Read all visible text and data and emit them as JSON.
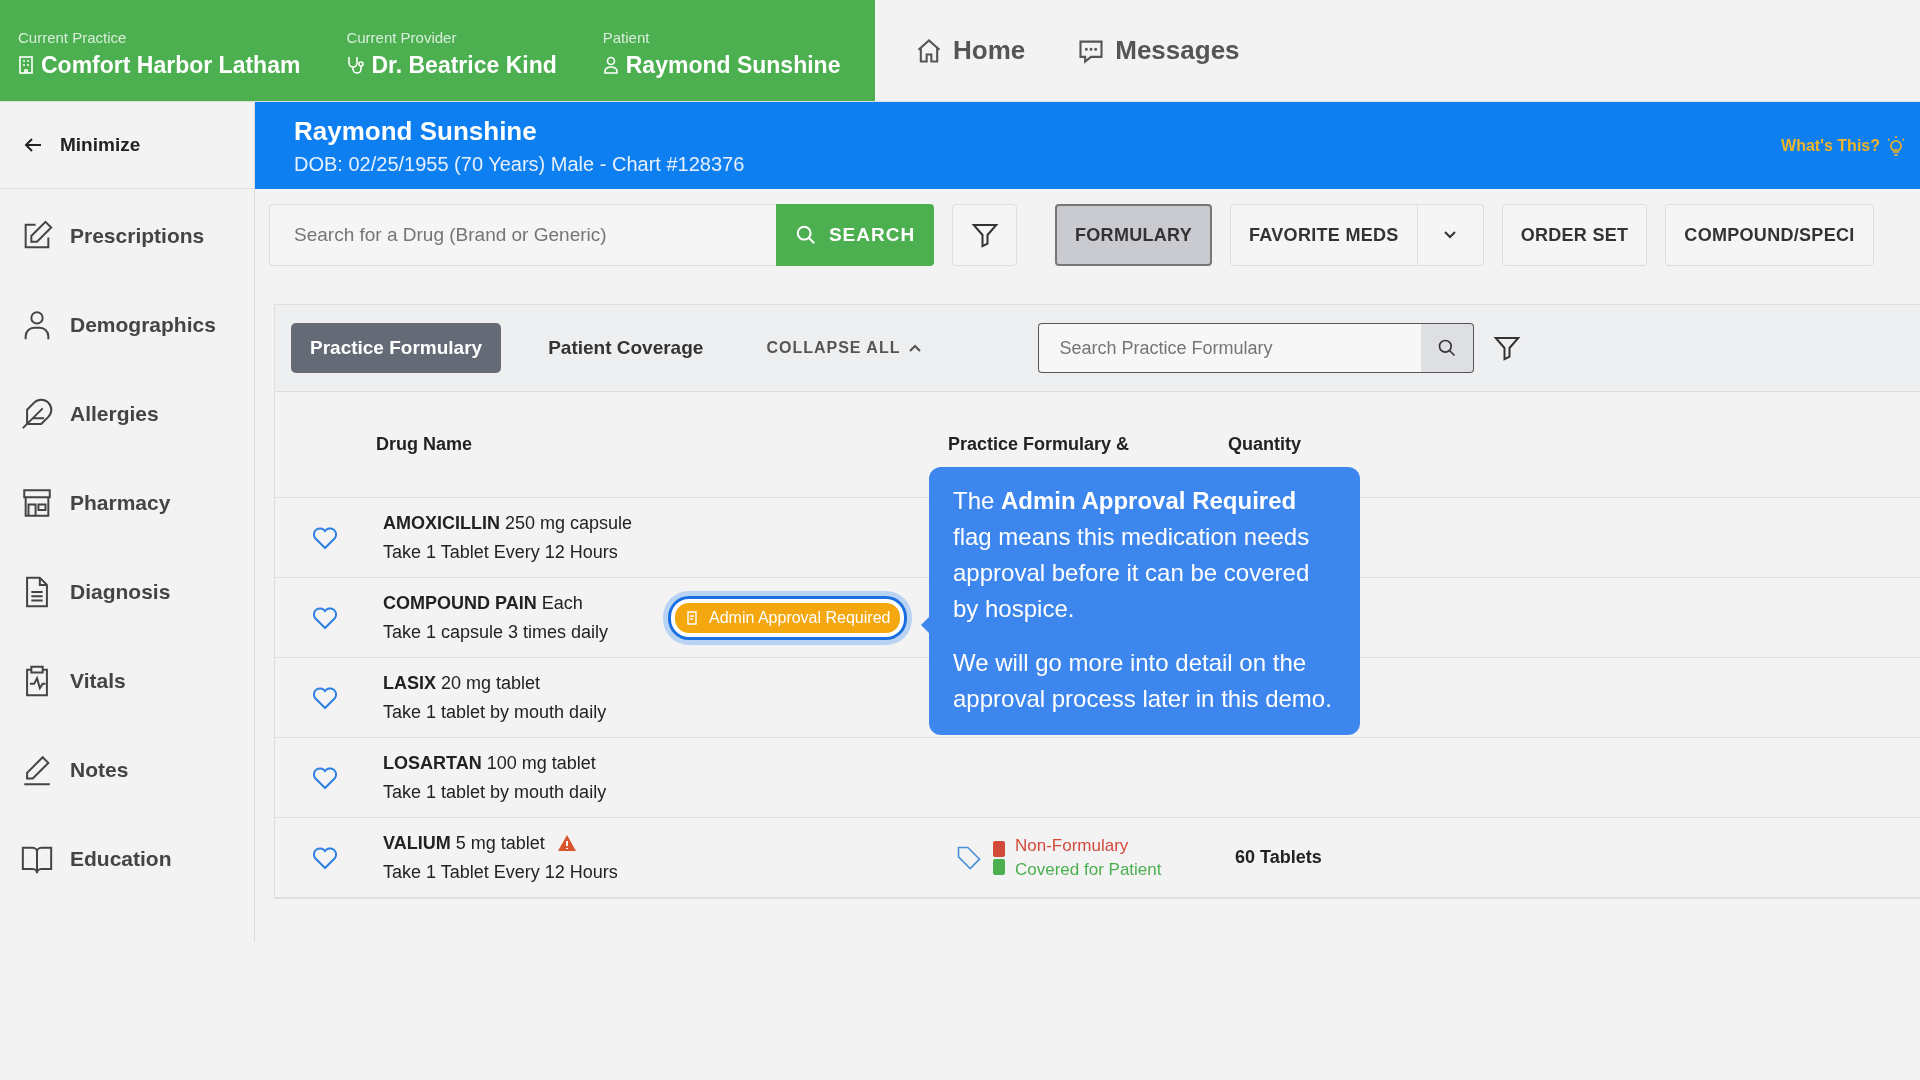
{
  "context_bar": [
    {
      "label": "Current Practice",
      "value": "Comfort Harbor Latham"
    },
    {
      "label": "Current Provider",
      "value": "Dr. Beatrice Kind"
    },
    {
      "label": "Patient",
      "value": "Raymond Sunshine"
    }
  ],
  "nav_links": [
    {
      "label": "Home"
    },
    {
      "label": "Messages"
    }
  ],
  "sidebar": {
    "minimize": "Minimize",
    "items": [
      {
        "label": "Prescriptions"
      },
      {
        "label": "Demographics"
      },
      {
        "label": "Allergies"
      },
      {
        "label": "Pharmacy"
      },
      {
        "label": "Diagnosis"
      },
      {
        "label": "Vitals"
      },
      {
        "label": "Notes"
      },
      {
        "label": "Education"
      }
    ]
  },
  "patient_banner": {
    "name": "Raymond Sunshine",
    "details": "DOB: 02/25/1955 (70 Years) Male - Chart #128376",
    "help_link": "What's This?"
  },
  "drug_search": {
    "placeholder": "Search for a Drug (Brand or Generic)",
    "button": "SEARCH"
  },
  "toolbar_buttons": [
    {
      "label": "FORMULARY",
      "selected": true,
      "dropdown": false
    },
    {
      "label": "FAVORITE MEDS",
      "selected": false,
      "dropdown": true
    },
    {
      "label": "ORDER SET",
      "selected": false,
      "dropdown": false
    },
    {
      "label": "COMPOUND/SPECI",
      "selected": false,
      "dropdown": false
    }
  ],
  "formulary_tabs": [
    {
      "label": "Practice Formulary",
      "selected": true
    },
    {
      "label": "Patient Coverage",
      "selected": false
    }
  ],
  "collapse_all": "COLLAPSE ALL",
  "formulary_search": {
    "placeholder": "Search Practice Formulary"
  },
  "table": {
    "columns": [
      "Drug Name",
      "Practice Formulary &",
      "Quantity"
    ],
    "rows": [
      {
        "drug": "**AMOXICILLIN** 250 mg capsule",
        "sig": "Take 1 Tablet Every 12 Hours",
        "warning": false
      },
      {
        "drug": "**COMPOUND PAIN** Each",
        "sig": "Take 1 capsule 3 times daily",
        "warning": false,
        "badge": "Admin Approval Required"
      },
      {
        "drug": "**LASIX** 20 mg tablet",
        "sig": "Take 1 tablet by mouth daily",
        "warning": false
      },
      {
        "drug": "**LOSARTAN** 100 mg tablet",
        "sig": "Take 1 tablet by mouth daily",
        "warning": false
      },
      {
        "drug": "**VALIUM** 5 mg tablet",
        "sig": "Take 1 Tablet Every 12 Hours",
        "warning": true,
        "status": [
          {
            "text": "Non-Formulary",
            "color": "#d24a3a"
          },
          {
            "text": "Covered for Patient",
            "color": "#4caf50"
          }
        ],
        "quantity": "60 Tablets"
      }
    ]
  },
  "tooltip": {
    "paragraphs": [
      "The **Admin Approval Required** flag means this medication needs approval before it can be covered by hospice.",
      "We will go more into detail on the approval process later in this demo."
    ]
  }
}
